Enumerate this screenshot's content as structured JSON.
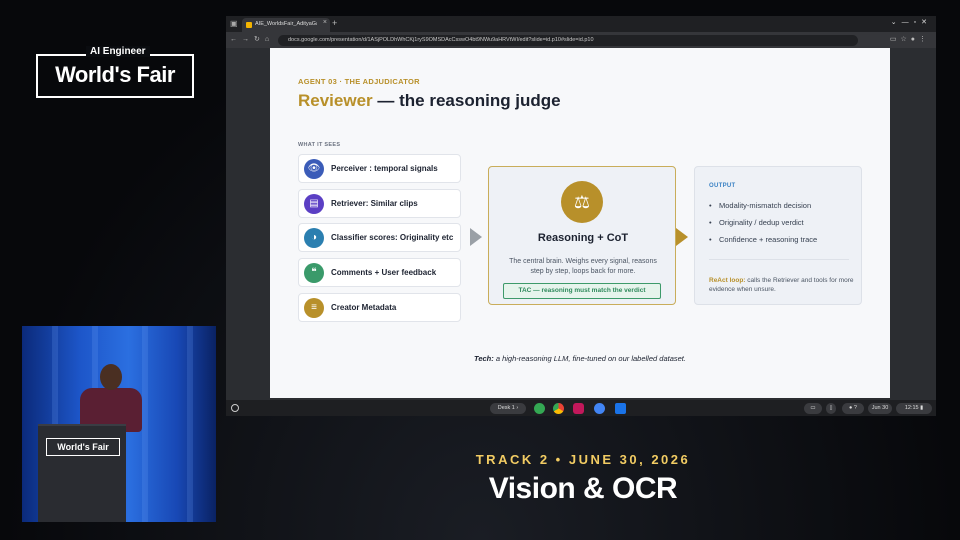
{
  "event": {
    "brand_small": "AI Engineer",
    "brand_main": "World's Fair",
    "podium_logo": "World's Fair",
    "track_line": "TRACK 2 • JUNE 30, 2026",
    "session_title": "Vision & OCR"
  },
  "browser": {
    "tab_title": "AIE_WorldsFair_AdityaGautam...",
    "url": "docs.google.com/presentation/d/1ASjPOLDhWhCKj1ryS9OMSDAcCsswO4bt9NWu9aHRVtWI/edit?slide=id.p10#slide=id.p10"
  },
  "slide": {
    "kicker": "AGENT 03 · THE ADJUDICATOR",
    "title_highlight": "Reviewer",
    "title_rest": " — the reasoning judge",
    "sees_label": "WHAT IT SEES",
    "inputs": [
      {
        "label": "Perceiver : temporal signals",
        "icon": "eye-icon",
        "color": "#3b5cb8",
        "glyph": "👁"
      },
      {
        "label": "Retriever: Similar clips",
        "icon": "document-icon",
        "color": "#5b3fc4",
        "glyph": "▤"
      },
      {
        "label": "Classifier scores: Originality etc",
        "icon": "brain-icon",
        "color": "#2b7fb0",
        "glyph": "◑"
      },
      {
        "label": "Comments + User feedback",
        "icon": "chat-icon",
        "color": "#3a9a6a",
        "glyph": "❝"
      },
      {
        "label": "Creator Metadata",
        "icon": "database-icon",
        "color": "#b8902a",
        "glyph": "≡"
      }
    ],
    "center": {
      "icon": "scale-icon",
      "title": "Reasoning + CoT",
      "description": "The central brain. Weighs every signal, reasons step by step, loops back for more.",
      "tac": "TAC — reasoning must match the verdict"
    },
    "output": {
      "label": "OUTPUT",
      "items": [
        "Modality-mismatch decision",
        "Originality / dedup verdict",
        "Confidence + reasoning trace"
      ],
      "react_key": "ReAct loop:",
      "react_text": " calls the Retriever and tools for more evidence when unsure."
    },
    "tech_key": "Tech:",
    "tech_text": " a high-reasoning LLM, fine-tuned on our labelled dataset."
  },
  "shelf": {
    "desk_label": "Desk 1",
    "date": "Jun 30",
    "time": "12:15"
  },
  "colors": {
    "accent_gold": "#b8902a",
    "track_gold": "#f2cc63",
    "tac_green": "#2f8a5c",
    "output_blue": "#3b82c4"
  }
}
